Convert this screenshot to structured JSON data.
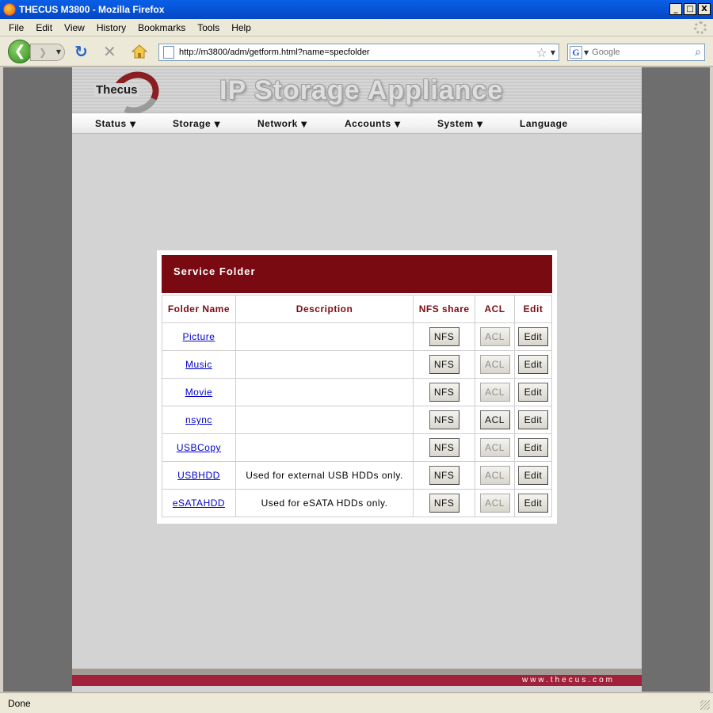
{
  "window": {
    "title": "THECUS M3800 - Mozilla Firefox",
    "minimize": "_",
    "maximize": "□",
    "close": "X"
  },
  "menubar": [
    "File",
    "Edit",
    "View",
    "History",
    "Bookmarks",
    "Tools",
    "Help"
  ],
  "toolbar": {
    "url": "http://m3800/adm/getform.html?name=specfolder",
    "search_placeholder": "Google",
    "icons": [
      "back-arrow-icon",
      "forward-arrow-icon",
      "reload-icon",
      "stop-icon",
      "home-icon",
      "page-icon",
      "bookmark-star-icon",
      "google-icon",
      "search-magnifier-icon"
    ]
  },
  "banner": {
    "logo_text": "Thecus",
    "title": "IP Storage Appliance"
  },
  "topnav": [
    {
      "label": "Status",
      "has_menu": true
    },
    {
      "label": "Storage",
      "has_menu": true
    },
    {
      "label": "Network",
      "has_menu": true
    },
    {
      "label": "Accounts",
      "has_menu": true
    },
    {
      "label": "System",
      "has_menu": true
    },
    {
      "label": "Language",
      "has_menu": false
    }
  ],
  "service_folder": {
    "title": "Service Folder",
    "columns": [
      "Folder Name",
      "Description",
      "NFS share",
      "ACL",
      "Edit"
    ],
    "rows": [
      {
        "name": "Picture",
        "description": "",
        "nfs": "NFS",
        "acl": "ACL",
        "acl_enabled": false,
        "edit": "Edit"
      },
      {
        "name": "Music",
        "description": "",
        "nfs": "NFS",
        "acl": "ACL",
        "acl_enabled": false,
        "edit": "Edit"
      },
      {
        "name": "Movie",
        "description": "",
        "nfs": "NFS",
        "acl": "ACL",
        "acl_enabled": false,
        "edit": "Edit"
      },
      {
        "name": "nsync",
        "description": "",
        "nfs": "NFS",
        "acl": "ACL",
        "acl_enabled": true,
        "edit": "Edit"
      },
      {
        "name": "USBCopy",
        "description": "",
        "nfs": "NFS",
        "acl": "ACL",
        "acl_enabled": false,
        "edit": "Edit"
      },
      {
        "name": "USBHDD",
        "description": "Used for external USB HDDs only.",
        "nfs": "NFS",
        "acl": "ACL",
        "acl_enabled": false,
        "edit": "Edit"
      },
      {
        "name": "eSATAHDD",
        "description": "Used for eSATA HDDs only.",
        "nfs": "NFS",
        "acl": "ACL",
        "acl_enabled": false,
        "edit": "Edit"
      }
    ]
  },
  "footer": {
    "url_text": "www.thecus.com"
  },
  "status": {
    "text": "Done"
  },
  "colors": {
    "panel_header": "#7a0a12",
    "footer_bar": "#a2213a",
    "link": "#0000cc"
  }
}
